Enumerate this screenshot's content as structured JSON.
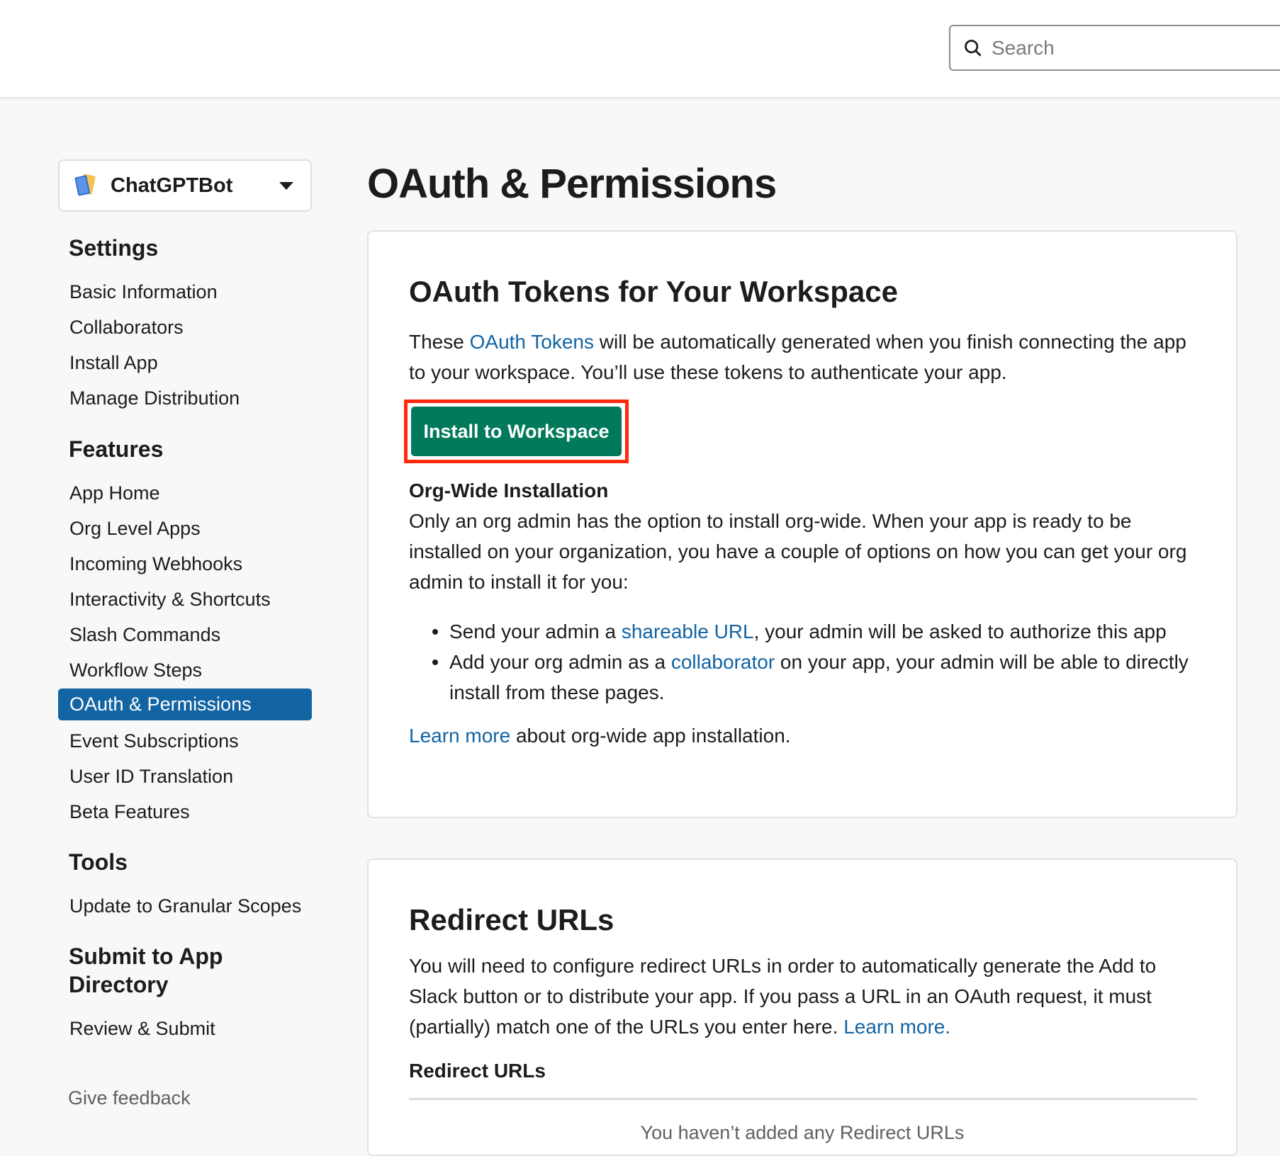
{
  "header": {
    "search_placeholder": "Search"
  },
  "sidebar": {
    "app_name": "ChatGPTBot",
    "sections": [
      {
        "heading": "Settings",
        "items": [
          "Basic Information",
          "Collaborators",
          "Install App",
          "Manage Distribution"
        ]
      },
      {
        "heading": "Features",
        "items": [
          "App Home",
          "Org Level Apps",
          "Incoming Webhooks",
          "Interactivity & Shortcuts",
          "Slash Commands",
          "Workflow Steps",
          "OAuth & Permissions",
          "Event Subscriptions",
          "User ID Translation",
          "Beta Features"
        ]
      },
      {
        "heading": "Tools",
        "items": [
          "Update to Granular Scopes"
        ]
      },
      {
        "heading": "Submit to App Directory",
        "items": [
          "Review & Submit"
        ]
      }
    ],
    "active_item": "OAuth & Permissions",
    "feedback": "Give feedback"
  },
  "main": {
    "page_title": "OAuth & Permissions",
    "tokens_card": {
      "title": "OAuth Tokens for Your Workspace",
      "intro_before": "These ",
      "intro_link": "OAuth Tokens",
      "intro_after": " will be automatically generated when you finish connecting the app to your workspace. You’ll use these tokens to authenticate your app.",
      "install_button": "Install to Workspace",
      "org_heading": "Org-Wide Installation",
      "org_text": "Only an org admin has the option to install org-wide. When your app is ready to be installed on your organization, you have a couple of options on how you can get your org admin to install it for you:",
      "bullet1_before": "Send your admin a ",
      "bullet1_link": "shareable URL",
      "bullet1_after": ", your admin will be asked to authorize this app",
      "bullet2_before": "Add your org admin as a ",
      "bullet2_link": "collaborator",
      "bullet2_after": " on your app, your admin will be able to directly install from these pages.",
      "learn_link": "Learn more",
      "learn_after": " about org-wide app installation."
    },
    "redirect_card": {
      "title": "Redirect URLs",
      "text_before": "You will need to configure redirect URLs in order to automatically generate the Add to Slack button or to distribute your app. If you pass a URL in an OAuth request, it must (partially) match one of the URLs you enter here. ",
      "text_link": "Learn more.",
      "subheading": "Redirect URLs",
      "empty_message": "You haven’t added any Redirect URLs"
    }
  },
  "colors": {
    "accent_blue": "#1264a3",
    "install_green": "#007a5a",
    "highlight_red": "#ff2a0c"
  }
}
